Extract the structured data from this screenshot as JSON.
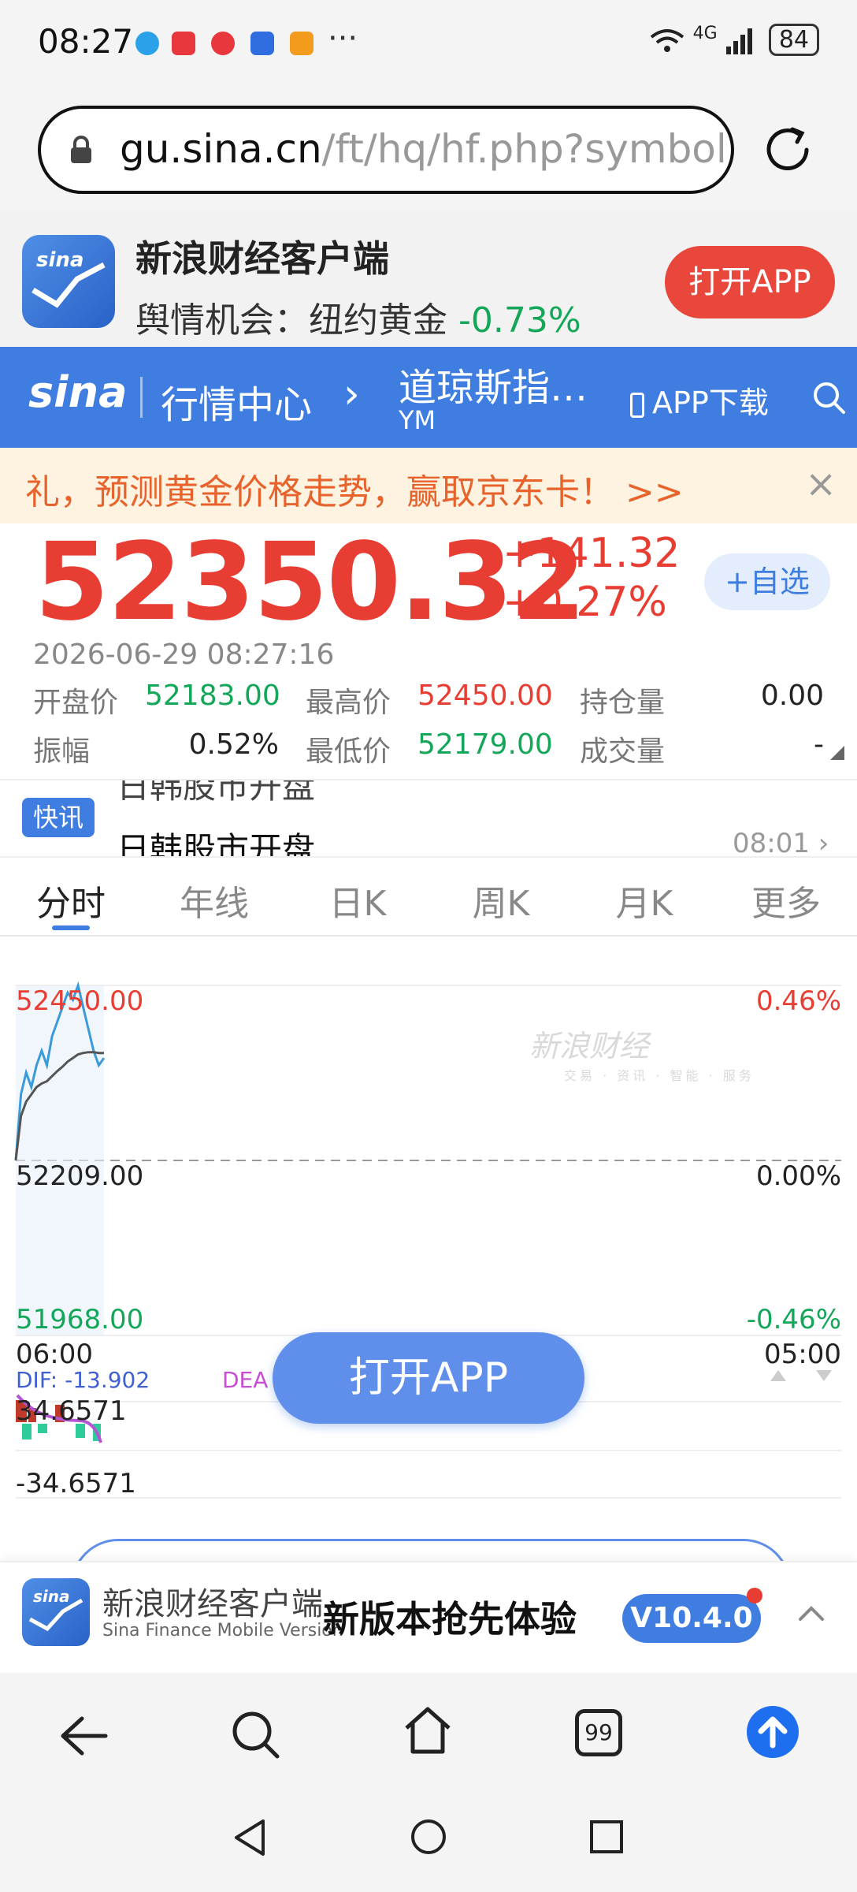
{
  "status_bar": {
    "time": "08:27",
    "more": "···",
    "network": "4G",
    "battery": "84"
  },
  "browser": {
    "url_domain": "gu.sina.cn",
    "url_path": "/ft/hq/hf.php?symbol="
  },
  "app_promo": {
    "title": "新浪财经客户端",
    "subtitle_label": "舆情机会：纽约黄金",
    "subtitle_change": "-0.73%",
    "open_button": "打开APP"
  },
  "nav": {
    "logo": "sina",
    "breadcrumb": "行情中心",
    "symbol_name": "道琼斯指…",
    "symbol_code": "YM",
    "download": "APP下载"
  },
  "banner": {
    "text": "礼，预测黄金价格走势，赢取京东卡！ >>"
  },
  "quote": {
    "price": "52350.32",
    "change": "+141.32",
    "change_pct": "+0.27%",
    "add_watchlist": "+自选",
    "timestamp": "2026-06-29 08:27:16",
    "rows": [
      [
        {
          "label": "开盘价",
          "value": "52183.00"
        },
        {
          "label": "最高价",
          "value": "52450.00"
        },
        {
          "label": "持仓量",
          "value": "0.00"
        }
      ],
      [
        {
          "label": "振幅",
          "value": "0.52%"
        },
        {
          "label": "最低价",
          "value": "52179.00"
        },
        {
          "label": "成交量",
          "value": "-"
        }
      ]
    ]
  },
  "news": {
    "tag": "快讯",
    "headline": "日韩股市开盘",
    "time": "08:01"
  },
  "tabs": [
    "分时",
    "年线",
    "日K",
    "周K",
    "月K",
    "更多"
  ],
  "chart": {
    "price_high": "52450.00",
    "price_mid": "52209.00",
    "price_low": "51968.00",
    "pct_high": "0.46%",
    "pct_mid": "0.00%",
    "pct_low": "-0.46%",
    "time_start": "06:00",
    "time_end": "05:00",
    "dif_label": "DIF: -13.902",
    "dea_label": "DEA",
    "macd_high": "34.6571",
    "macd_low": "-34.6571",
    "watermark": "新浪财经",
    "watermark_sub": "交易 · 资讯 · 智能 · 服务"
  },
  "chart_data": {
    "type": "line",
    "title": "",
    "xlabel": "",
    "ylabel": "",
    "x_range": [
      "06:00",
      "05:00"
    ],
    "ylim": [
      51968.0,
      52450.0
    ],
    "prev_close": 52209.0,
    "series": [
      {
        "values": [
          52209,
          52300,
          52330,
          52310,
          52340,
          52360,
          52340,
          52380,
          52400,
          52420,
          52440,
          52430,
          52450,
          52420,
          52390,
          52360,
          52340,
          52350
        ]
      },
      {
        "values": [
          52209,
          52270,
          52290,
          52300,
          52310,
          52315,
          52318,
          52325,
          52332,
          52338,
          52345,
          52350,
          52355,
          52357,
          52358,
          52358,
          52357,
          52357
        ]
      }
    ],
    "macd": {
      "dif": -13.902,
      "range": [
        -34.6571,
        34.6571
      ]
    }
  },
  "float_button": "打开APP",
  "bottom_promo": {
    "name": "新浪财经客户端",
    "english_name": "Sina Finance Mobile Version",
    "slogan": "新版本抢先体验",
    "version": "V10.4.0"
  },
  "toolbar": {
    "tabs_count": "99"
  },
  "colors": {
    "brand_blue": "#3f7ee0",
    "rise_red": "#e83d32",
    "fall_green": "#14a75a",
    "promo_red": "#e9473c"
  }
}
